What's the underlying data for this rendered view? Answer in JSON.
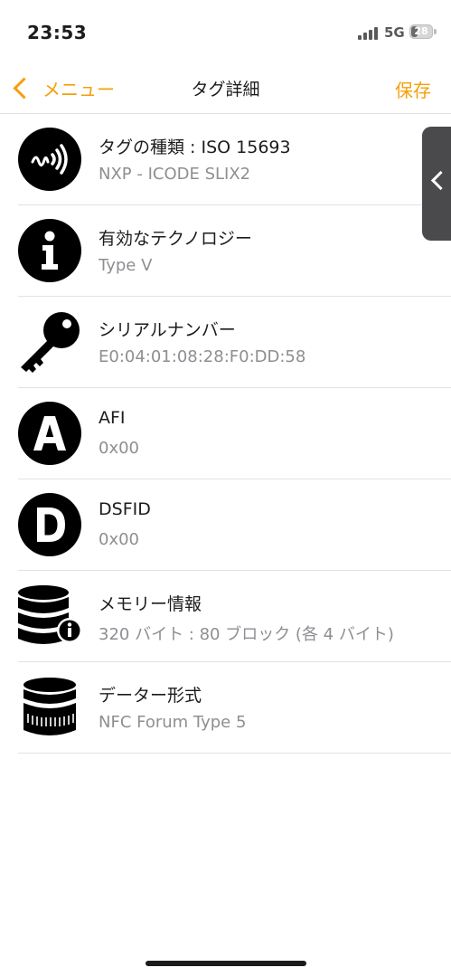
{
  "status_bar": {
    "time": "23:53",
    "network": "5G",
    "battery_level": "28"
  },
  "nav": {
    "back_label": "メニュー",
    "title": "タグ詳細",
    "save_label": "保存",
    "accent_color": "#f5a00a"
  },
  "rows": [
    {
      "icon": "nfc-wave-icon",
      "title": "タグの種類 : ISO 15693",
      "subtitle": "NXP - ICODE SLIX2"
    },
    {
      "icon": "info-icon",
      "title": "有効なテクノロジー",
      "subtitle": "Type V"
    },
    {
      "icon": "key-icon",
      "title": "シリアルナンバー",
      "subtitle": "E0:04:01:08:28:F0:DD:58"
    },
    {
      "icon": "letter-a-icon",
      "title": "AFI",
      "subtitle": "0x00"
    },
    {
      "icon": "letter-d-icon",
      "title": "DSFID",
      "subtitle": "0x00"
    },
    {
      "icon": "database-info-icon",
      "title": "メモリー情報",
      "subtitle": "320 バイト : 80 ブロック (各 4 バイト)"
    },
    {
      "icon": "data-format-icon",
      "title": "データー形式",
      "subtitle": "NFC Forum Type 5"
    }
  ]
}
